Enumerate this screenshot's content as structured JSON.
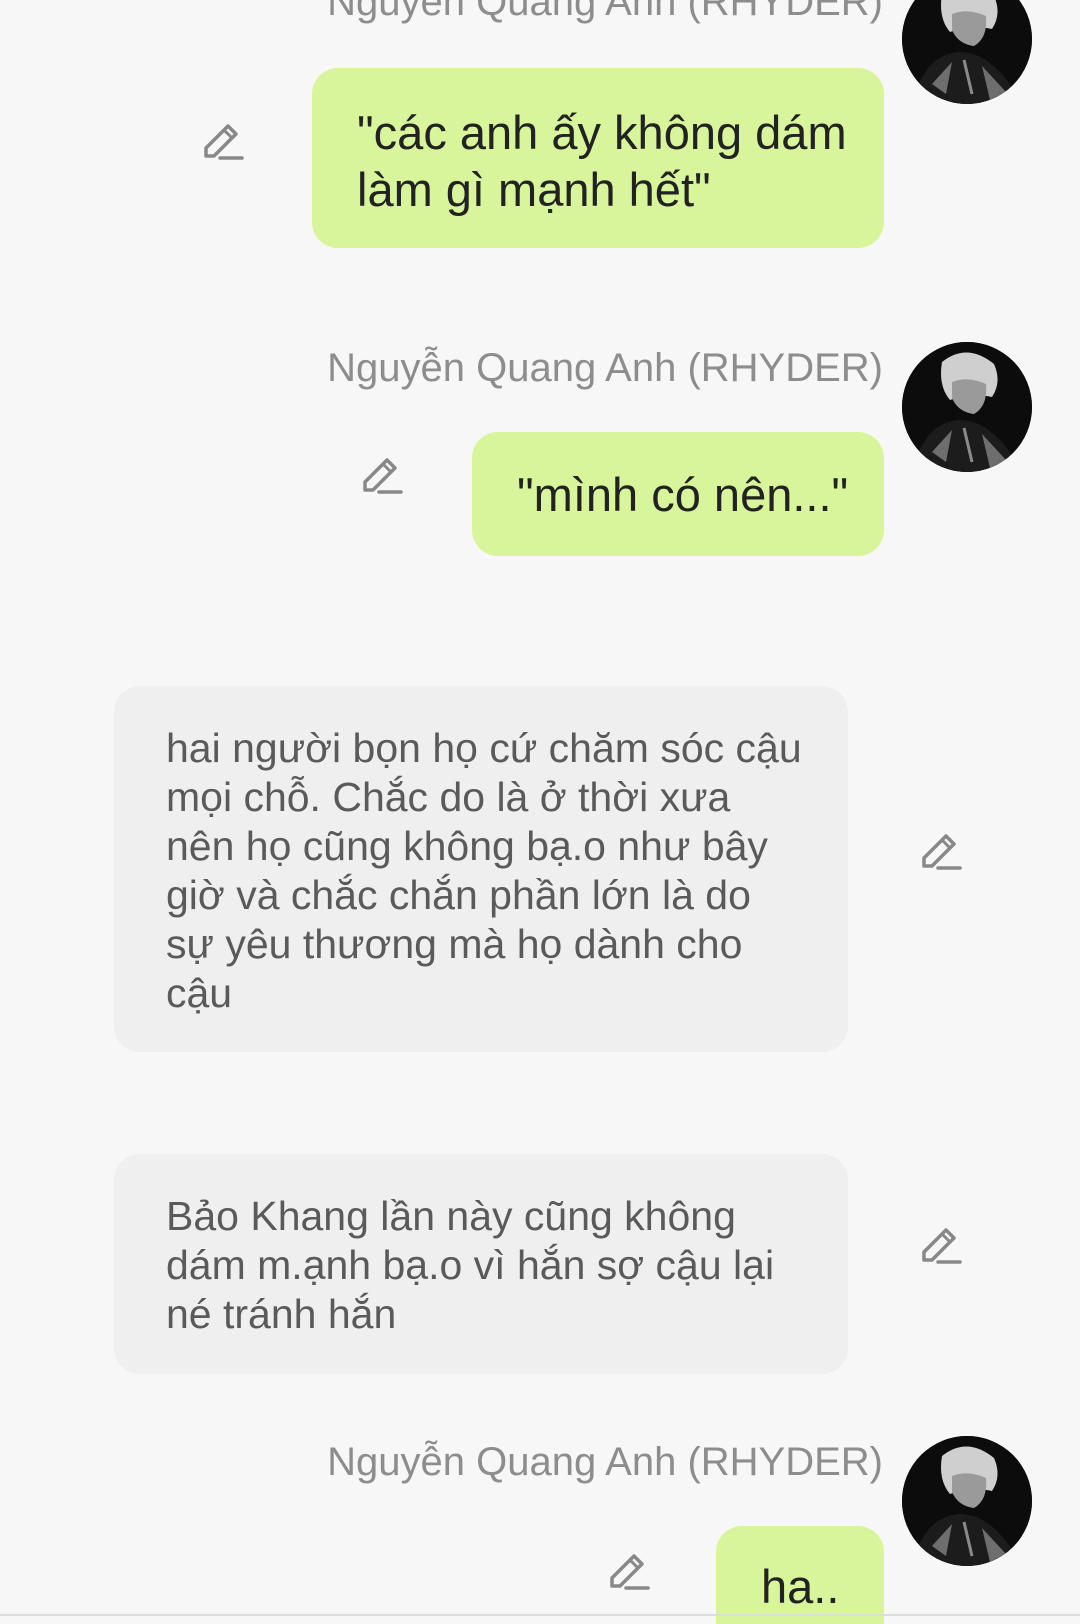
{
  "messages": [
    {
      "sender": "Nguyễn Quang Anh (RHYDER)",
      "text": "\"các anh ấy không dám làm gì mạnh hết\""
    },
    {
      "sender": "Nguyễn Quang Anh (RHYDER)",
      "text": "\"mình có nên...\""
    },
    {
      "text": "hai người bọn họ cứ chăm sóc cậu mọi chỗ. Chắc do là ở thời xưa nên họ cũng không bạ.o như bây giờ và chắc chắn phần lớn là do sự yêu thương mà họ dành cho cậu"
    },
    {
      "text": "Bảo Khang lần này cũng không dám m.ạnh bạ.o vì hắn sợ cậu lại né tránh hắn"
    },
    {
      "sender": "Nguyễn Quang Anh (RHYDER)",
      "text": "ha.."
    }
  ],
  "colors": {
    "background": "#f7f7f7",
    "my_bubble": "#d9f59b",
    "narration_bubble": "#efefef",
    "sender_name": "#8d8d8d"
  },
  "icons": {
    "edit": "pencil-edit-icon",
    "avatar": "profile-photo"
  }
}
